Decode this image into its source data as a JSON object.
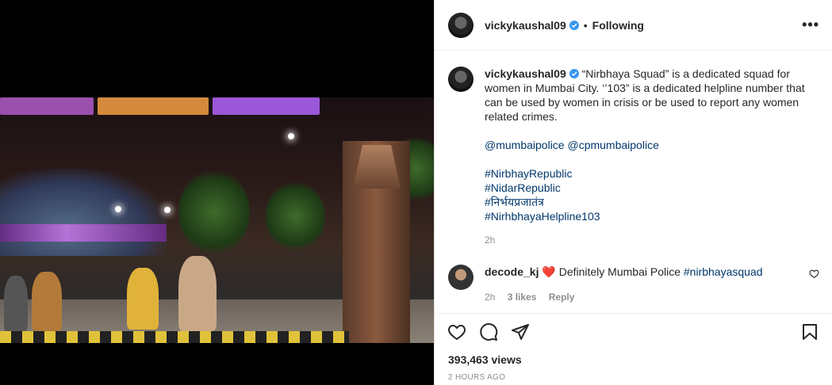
{
  "post": {
    "author": "vickykaushal09",
    "follow_status": "Following",
    "separator": "•",
    "more_label": "•••",
    "caption": {
      "lead": "“Nirbhaya Squad” is a dedicated squad for women in Mumbai City. ‘’103” is a dedicated helpline number that can be used by women in crisis or be used to report any women related crimes.",
      "mentions": [
        "@mumbaipolice",
        "@cpmumbaipolice"
      ],
      "hashtags": [
        "#NirbhayRepublic",
        "#NidarRepublic",
        "#निर्भयप्रजातंत्र",
        "#NirhbhayaHelpline103"
      ],
      "time": "2h"
    },
    "comment": {
      "user": "decode_kj",
      "emoji": "❤️",
      "text": "Definitely Mumbai Police",
      "hashtag": "#nirbhayasquad",
      "time": "2h",
      "likes": "3 likes",
      "reply": "Reply"
    },
    "views": "393,463 views",
    "posted": "2 HOURS AGO"
  },
  "icons": {
    "verified": "verified-badge-icon",
    "like": "heart-icon",
    "comment": "comment-bubble-icon",
    "share": "paper-plane-icon",
    "save": "bookmark-icon",
    "comment_like": "small-heart-icon"
  },
  "colors": {
    "verified": "#3897f0",
    "link": "#00376b",
    "muted": "#8e8e8e"
  }
}
